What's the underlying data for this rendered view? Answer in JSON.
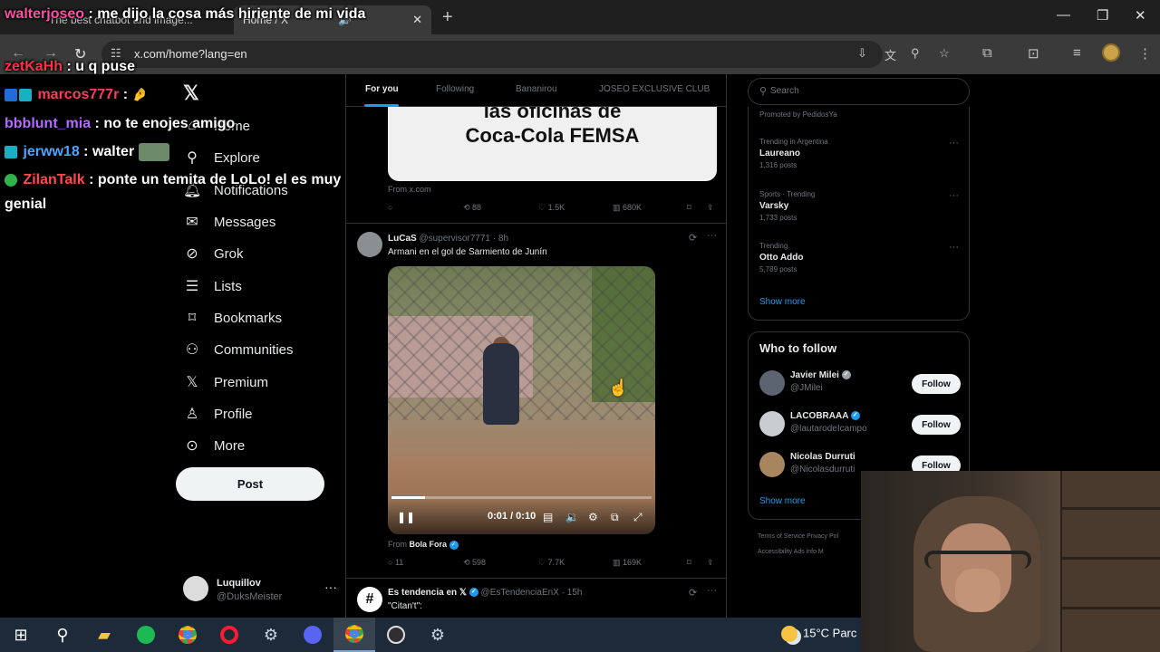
{
  "browser": {
    "tabs": [
      {
        "label": "The best chatbot and image..."
      },
      {
        "label": "Home / X"
      }
    ],
    "url": "x.com/home?lang=en"
  },
  "x": {
    "nav": [
      {
        "label": "Home",
        "icon": "home-icon"
      },
      {
        "label": "Explore",
        "icon": "search-icon"
      },
      {
        "label": "Notifications",
        "icon": "bell-icon"
      },
      {
        "label": "Messages",
        "icon": "mail-icon"
      },
      {
        "label": "Grok",
        "icon": "grok-icon"
      },
      {
        "label": "Lists",
        "icon": "list-icon"
      },
      {
        "label": "Bookmarks",
        "icon": "bookmark-icon"
      },
      {
        "label": "Communities",
        "icon": "communities-icon"
      },
      {
        "label": "Premium",
        "icon": "x-logo-icon"
      },
      {
        "label": "Profile",
        "icon": "profile-icon"
      },
      {
        "label": "More",
        "icon": "more-circle-icon"
      }
    ],
    "post_button": "Post",
    "account": {
      "name": "Luquillov",
      "handle": "@DuksMeister"
    }
  },
  "timeline": {
    "tabs": [
      "For you",
      "Following",
      "Bananirou",
      "JOSEO EXCLUSIVE CLUB"
    ],
    "card1": {
      "line1": "las oficinas de",
      "line2": "Coca-Cola FEMSA",
      "source": "From x.com"
    },
    "post1_stats": {
      "retweets": "88",
      "likes": "1.5K",
      "views": "680K"
    },
    "post2": {
      "author": "LuCaS",
      "handle": "@supervisor7771",
      "time": "8h",
      "text": "Armani en el gol de Sarmiento de Junín",
      "video_time": "0:01 / 0:10",
      "video_progress": 0.13,
      "source_prefix": "From",
      "source": "Bola Fora",
      "replies": "11",
      "retweets": "598",
      "likes": "7.7K",
      "views": "169K"
    },
    "post3": {
      "author": "Es tendencia en 𝕏",
      "handle": "@EsTendenciaEnX",
      "time": "15h",
      "text": "\"Citan't\":"
    }
  },
  "sidebar": {
    "search_placeholder": "Search",
    "promoted": "Promoted by PedidosYa",
    "trends": [
      {
        "context": "Trending in Argentina",
        "name": "Laureano",
        "count": "1,316 posts"
      },
      {
        "context": "Sports · Trending",
        "name": "Varsky",
        "count": "1,733 posts"
      },
      {
        "context": "Trending",
        "name": "Otto Addo",
        "count": "5,789 posts"
      }
    ],
    "show_more": "Show more",
    "who_to_follow": {
      "title": "Who to follow",
      "people": [
        {
          "name": "Javier Milei",
          "handle": "@JMilei",
          "button": "Follow"
        },
        {
          "name": "LACOBRAAA",
          "handle": "@lautarodeIcampo",
          "button": "Follow"
        },
        {
          "name": "Nicolas Durruti",
          "handle": "@Nicolasdurruti",
          "button": "Follow"
        }
      ],
      "show_more": "Show more"
    },
    "footer": {
      "line1": "Terms of Service   Privacy Pol",
      "line2": "Accessibility   Ads info   M"
    }
  },
  "chat": [
    {
      "user": "walterjoseo",
      "color": "#ff4fa3",
      "text": " : me dijo la cosa más hiriente de mi vida"
    },
    {
      "user": "zetKaHh",
      "color": "#ff2f4a",
      "text": " : u q puse"
    },
    {
      "user": "marcos777r",
      "color": "#ff3b5c",
      "text": " : "
    },
    {
      "user": "bbblunt_mia",
      "color": "#b46bff",
      "text": " : no te enojes amigo"
    },
    {
      "user": "jerww18",
      "color": "#49a7ff",
      "text": " : walter "
    },
    {
      "user": "ZilanTalk",
      "color": "#ff4a4a",
      "text": " : ponte un temita de LoLo! el es muy genial"
    }
  ],
  "taskbar": {
    "weather": "15°C  Parc"
  },
  "colors": {
    "accent": "#1d9bf0",
    "background": "#000000",
    "muted": "#71767b"
  }
}
